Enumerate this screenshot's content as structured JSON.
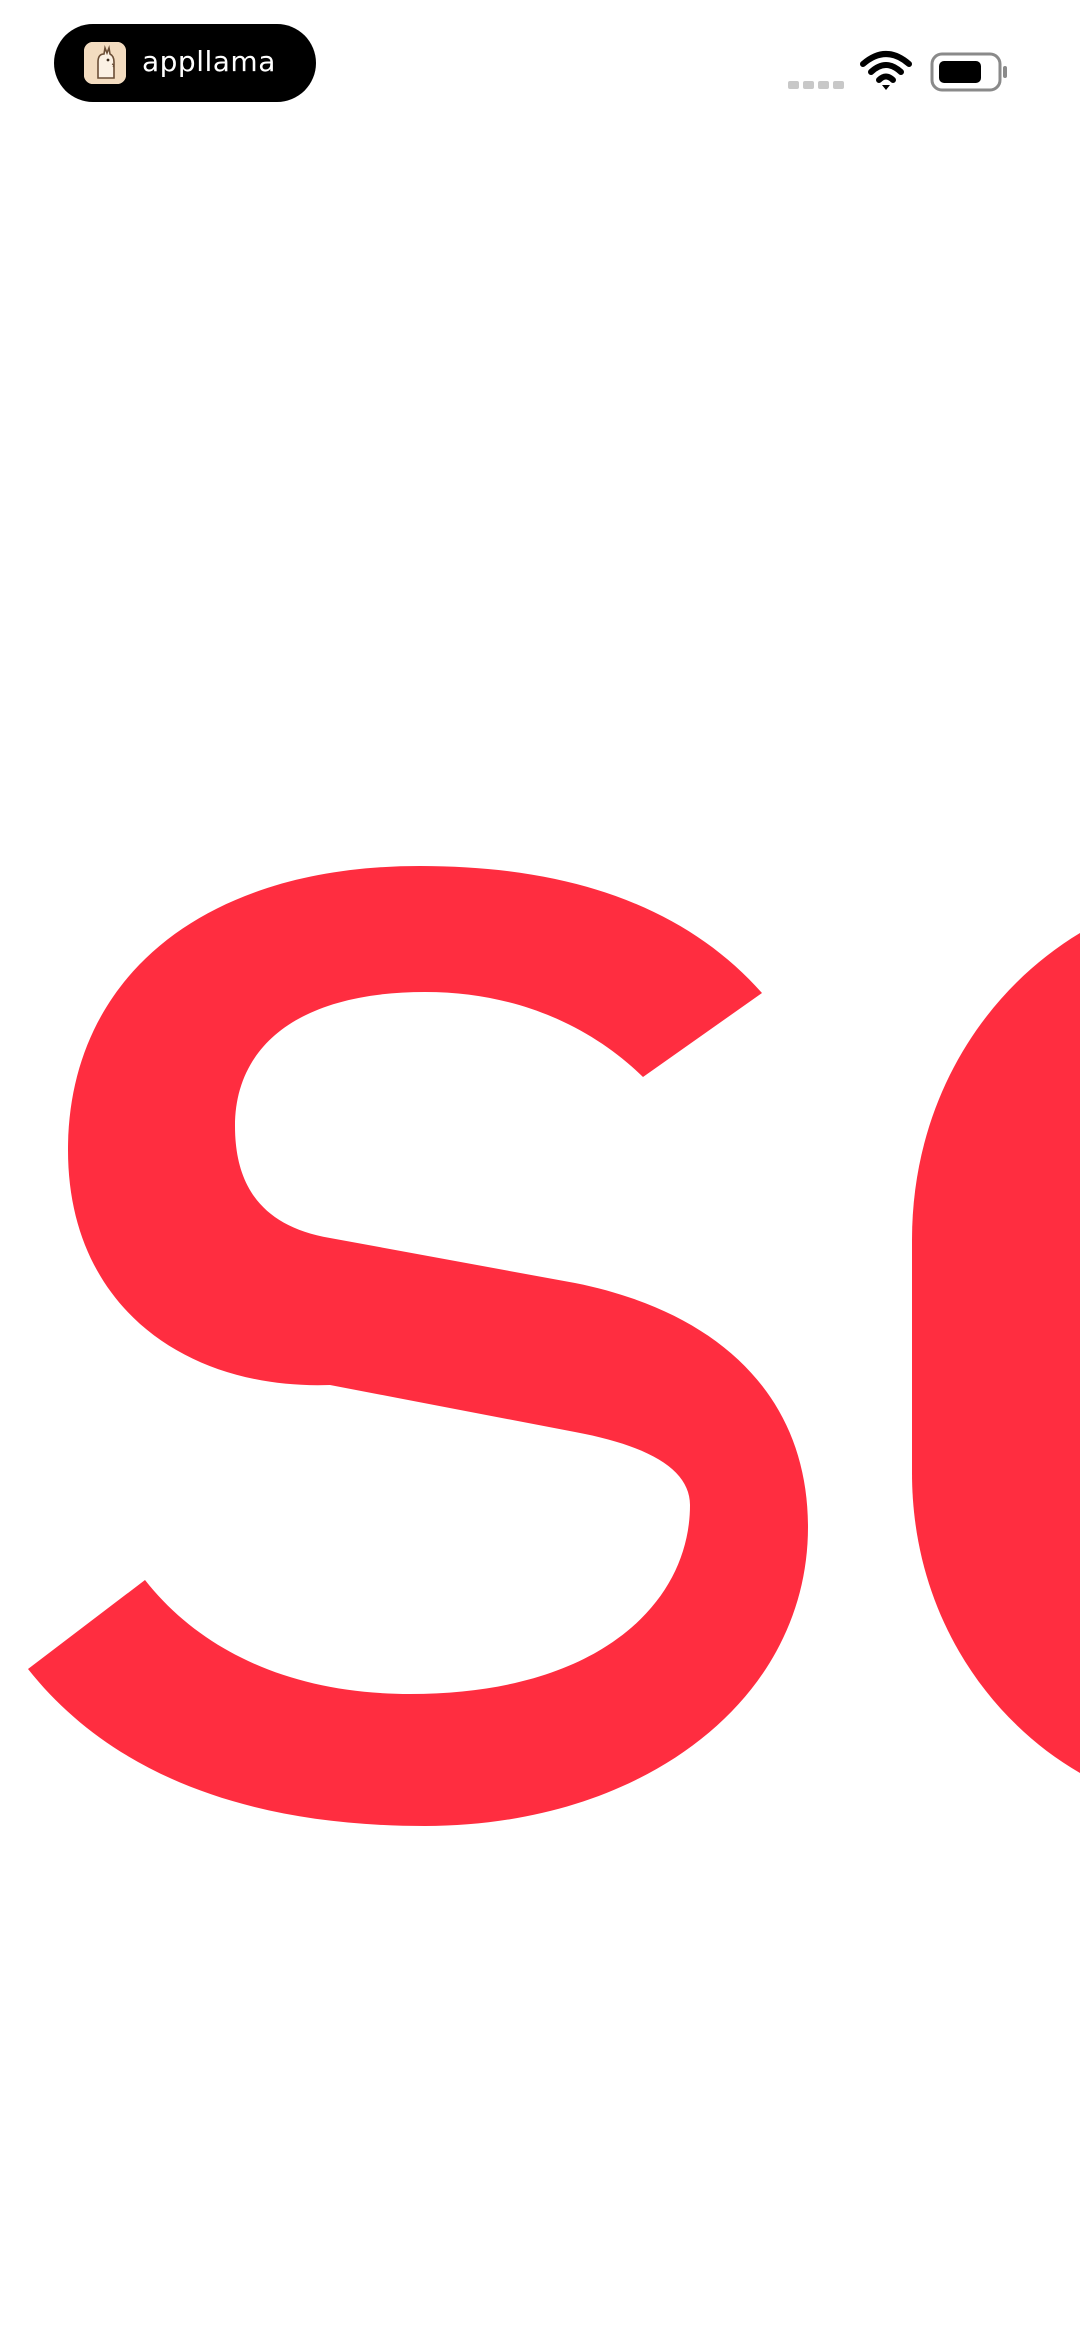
{
  "status_bar": {
    "app_name": "appllama",
    "app_icon": "llama-icon",
    "signal_icon": "cellular-signal-icon",
    "wifi_icon": "wifi-icon",
    "battery_icon": "battery-icon"
  },
  "hero": {
    "letters": "SC",
    "color": "#FF2D40"
  }
}
